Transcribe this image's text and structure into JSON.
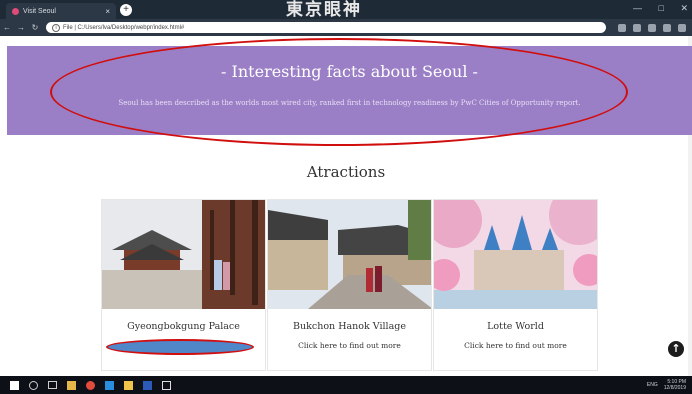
{
  "browser": {
    "tab_title": "Visit Seoul",
    "tab_close": "×",
    "new_tab": "+",
    "url": "File | C:/Users/lva/Desktop/webpr/index.html#",
    "watermark": "東京眼神",
    "window_controls": [
      "—",
      "□",
      "✕"
    ]
  },
  "hero": {
    "title": "- Interesting facts about Seoul -",
    "text": "Seoul has been described as the worlds most wired city, ranked first in technology readiness by PwC Cities of Opportunity report."
  },
  "attractions": {
    "heading": "Atractions",
    "cards": [
      {
        "name": "Gyeongbokgung Palace",
        "link": ""
      },
      {
        "name": "Bukchon Hanok Village",
        "link": "Click here to find out more"
      },
      {
        "name": "Lotte World",
        "link": "Click here to find out more"
      }
    ]
  },
  "scroll_top_icon": "arrow-up-icon",
  "taskbar": {
    "lang": "ENG",
    "time": "5:10 PM",
    "date": "12/8/2019"
  },
  "colors": {
    "hero_bg": "#9b7fc6",
    "annotation_red": "#d10e0e",
    "highlight_blue": "#4f87c9"
  }
}
